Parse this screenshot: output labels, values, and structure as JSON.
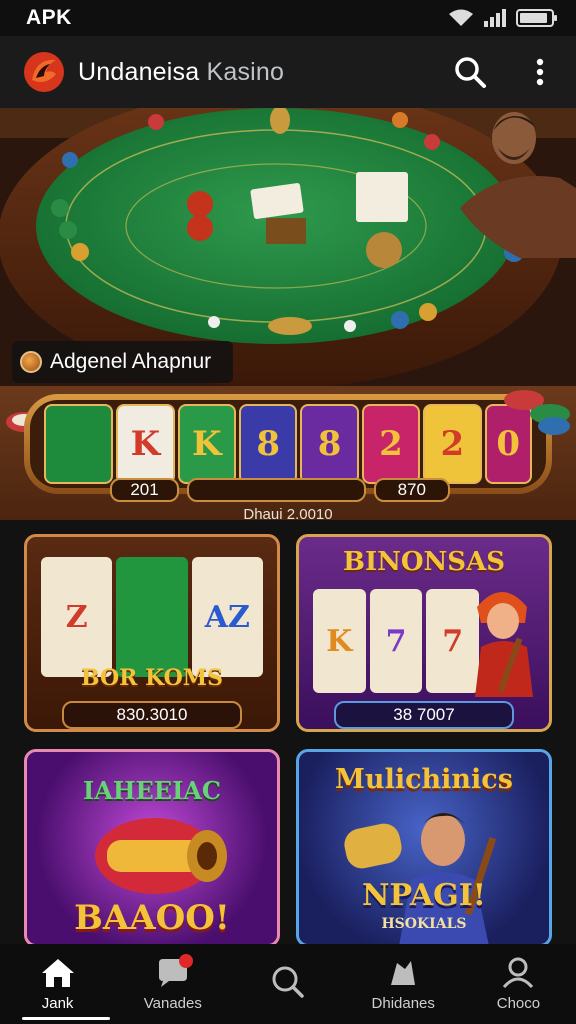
{
  "status_bar": {
    "carrier": "APK",
    "battery_level": 0.9
  },
  "app_bar": {
    "title_part1": "Undaneisa",
    "title_part2": "Kasino"
  },
  "hero": {
    "label": "Adgenel Ahapnur"
  },
  "slot_banner": {
    "reels": [
      "",
      "K",
      "K",
      "8",
      "8",
      "2",
      "2",
      "0"
    ],
    "values": [
      "201",
      "",
      "870"
    ],
    "caption": "Dhaui 2.0010"
  },
  "cards": [
    {
      "title": "",
      "banner": "BOR KOMS",
      "value": "830.3010",
      "reels": [
        "Z",
        "",
        "AZ"
      ]
    },
    {
      "title": "BINONSAS",
      "banner": "",
      "value": "38 7007",
      "reels": [
        "K",
        "7",
        "7"
      ]
    },
    {
      "title": "IAHEEIAC",
      "banner": "BAAOO!",
      "value": "",
      "reels": []
    },
    {
      "title": "Mulichinics",
      "banner": "NPAGI!",
      "subbanner": "HSOKIALS",
      "value": "",
      "reels": []
    }
  ],
  "bottom_nav": [
    {
      "label": "Jank",
      "icon": "home-icon"
    },
    {
      "label": "Vanades",
      "icon": "chat-icon"
    },
    {
      "label": "",
      "icon": "search-icon"
    },
    {
      "label": "Dhidanes",
      "icon": "cards-icon"
    },
    {
      "label": "Choco",
      "icon": "profile-icon"
    }
  ],
  "colors": {
    "felt": "#1f7a3a",
    "wood": "#5a2d12",
    "gold": "#d9a44a",
    "nav_bg": "#0d0d0e"
  }
}
